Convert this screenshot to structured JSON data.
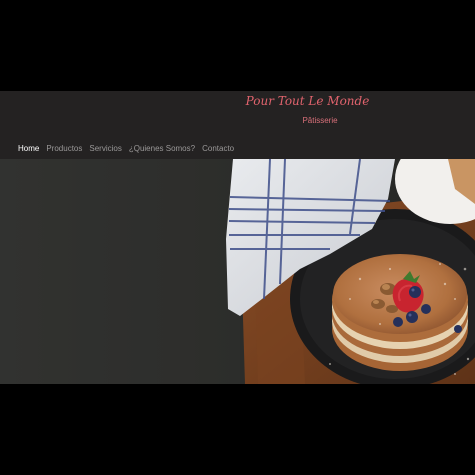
{
  "header": {
    "brand": "Pour Tout Le Monde",
    "tagline": "Pâtisserie"
  },
  "nav": {
    "items": [
      {
        "label": "Home",
        "active": true
      },
      {
        "label": "Productos",
        "active": false
      },
      {
        "label": "Servicios",
        "active": false
      },
      {
        "label": "¿Quienes Somos?",
        "active": false
      },
      {
        "label": "Contacto",
        "active": false
      }
    ]
  },
  "colors": {
    "header_bg": "#242222",
    "brand_pink": "#e0636d",
    "nav_active": "#ffffff",
    "nav_inactive": "#9a9898",
    "hero_dark": "#2c2d2b"
  }
}
